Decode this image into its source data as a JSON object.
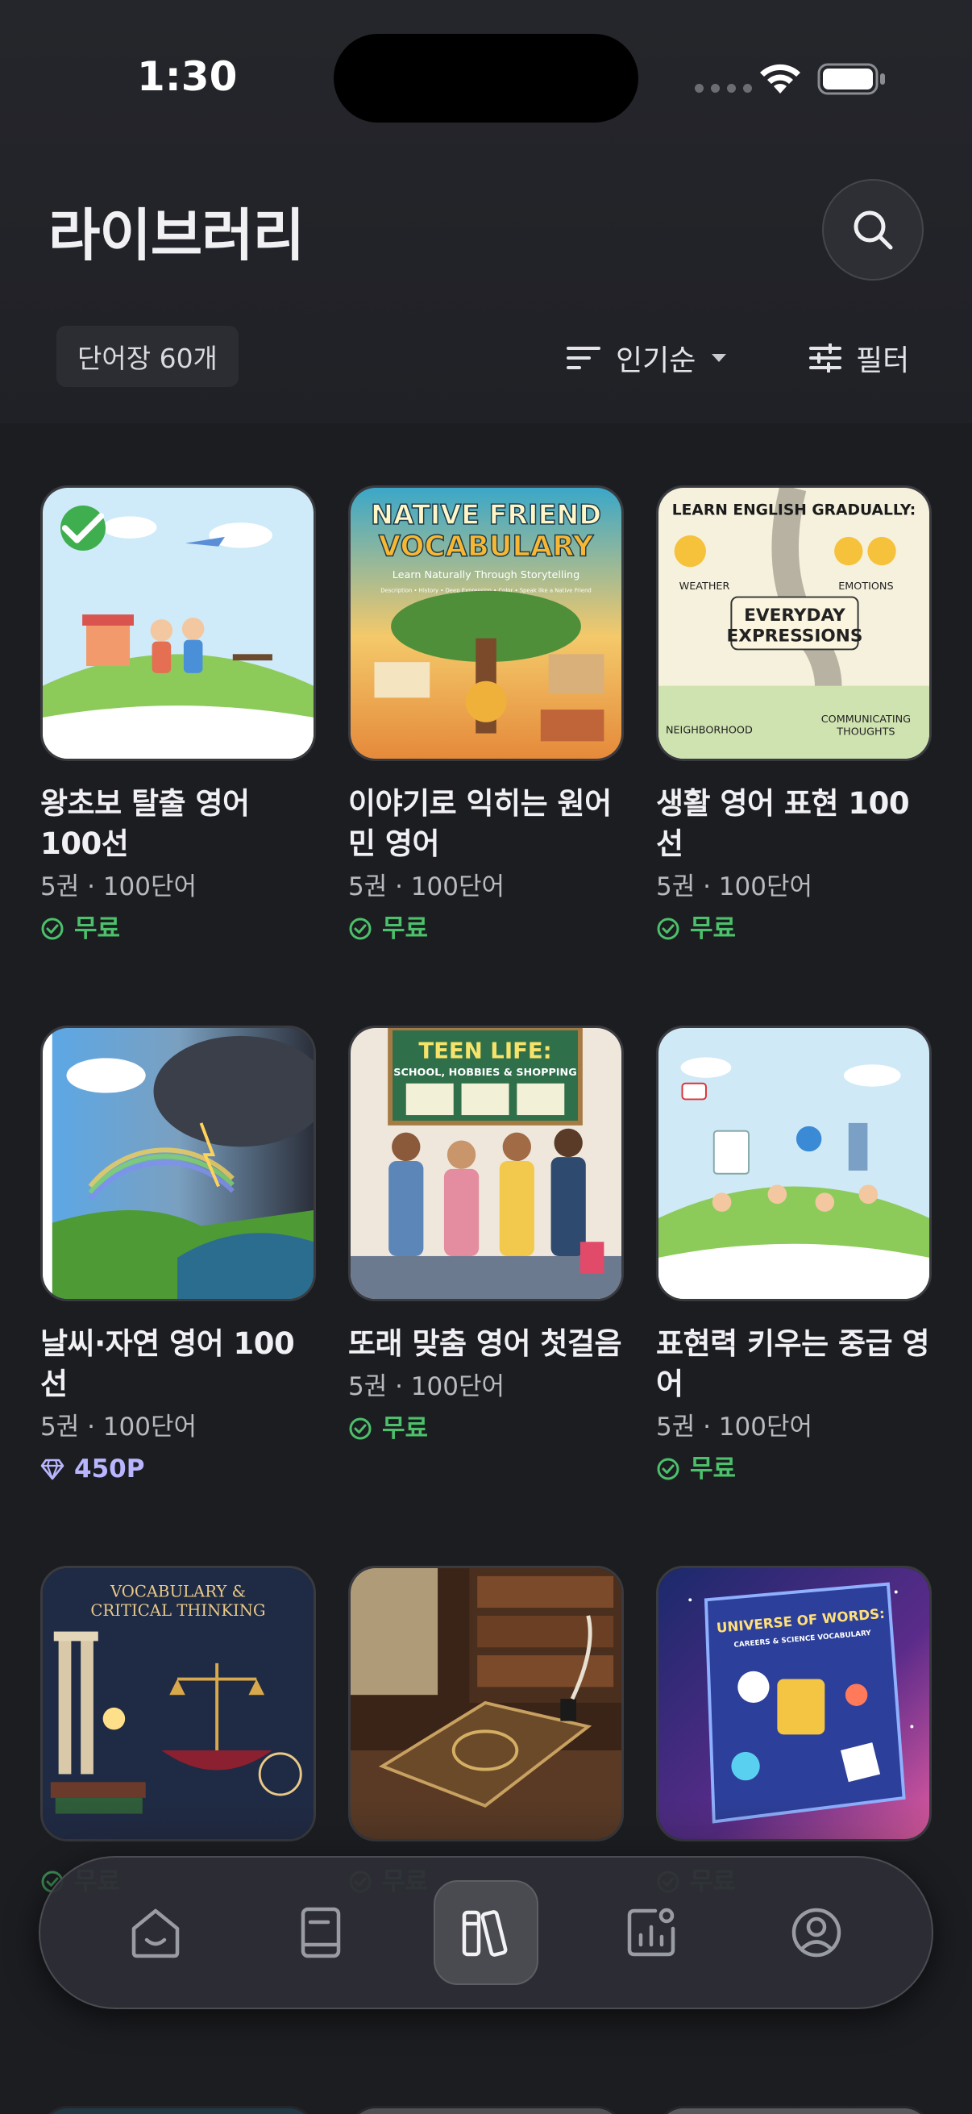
{
  "status_bar": {
    "time": "1:30"
  },
  "header": {
    "title": "라이브러리"
  },
  "controls": {
    "count_label": "단어장 60개",
    "sort_label": "인기순",
    "filter_label": "필터"
  },
  "books": [
    {
      "title": "왕초보 탈출 영어 100선",
      "meta": "5권 · 100단어",
      "price": "무료",
      "price_type": "free",
      "owned": true
    },
    {
      "title": "이야기로 익히는 원어민 영어",
      "meta": "5권 · 100단어",
      "price": "무료",
      "price_type": "free",
      "owned": false,
      "cover_text": {
        "line1": "NATIVE FRIEND",
        "line2": "VOCABULARY",
        "line3": "Learn Naturally Through Storytelling",
        "line4": "Description • History • Deep Expression • Color • Speak like a Native Friend"
      }
    },
    {
      "title": "생활 영어 표현 100선",
      "meta": "5권 · 100단어",
      "price": "무료",
      "price_type": "free",
      "owned": false,
      "cover_text": {
        "top": "LEARN ENGLISH GRADUALLY:",
        "weather": "WEATHER",
        "emotions": "EMOTIONS",
        "center1": "EVERYDAY",
        "center2": "EXPRESSIONS",
        "neighborhood": "NEIGHBORHOOD",
        "comm1": "COMMUNICATING",
        "comm2": "THOUGHTS"
      }
    },
    {
      "title": "날씨·자연 영어 100선",
      "meta": "5권 · 100단어",
      "price": "450P",
      "price_type": "points",
      "owned": false
    },
    {
      "title": "또래 맞춤 영어 첫걸음",
      "meta": "5권 · 100단어",
      "price": "무료",
      "price_type": "free",
      "owned": false,
      "cover_text": {
        "line1": "TEEN LIFE:",
        "line2": "SCHOOL, HOBBIES & SHOPPING"
      }
    },
    {
      "title": "표현력 키우는 중급 영어",
      "meta": "5권 · 100단어",
      "price": "무료",
      "price_type": "free",
      "owned": false
    },
    {
      "title": "",
      "meta": "",
      "price": "무료",
      "price_type": "free",
      "owned": false,
      "cover_text": {
        "line1": "VOCABULARY &",
        "line2": "CRITICAL THINKING"
      }
    },
    {
      "title": "",
      "meta": "",
      "price": "무료",
      "price_type": "free",
      "owned": false
    },
    {
      "title": "",
      "meta": "",
      "price": "무료",
      "price_type": "free",
      "owned": false,
      "cover_text": {
        "line1": "UNIVERSE OF WORDS:",
        "line2": "CAREERS & SCIENCE VOCABULARY"
      }
    }
  ],
  "tab_bar": {
    "tabs": [
      "home",
      "wordbook",
      "library",
      "stats",
      "profile"
    ],
    "active": "library"
  },
  "colors": {
    "accent_free": "#4cc06a",
    "accent_points": "#b9b6ff",
    "background": "#1c1d21"
  }
}
